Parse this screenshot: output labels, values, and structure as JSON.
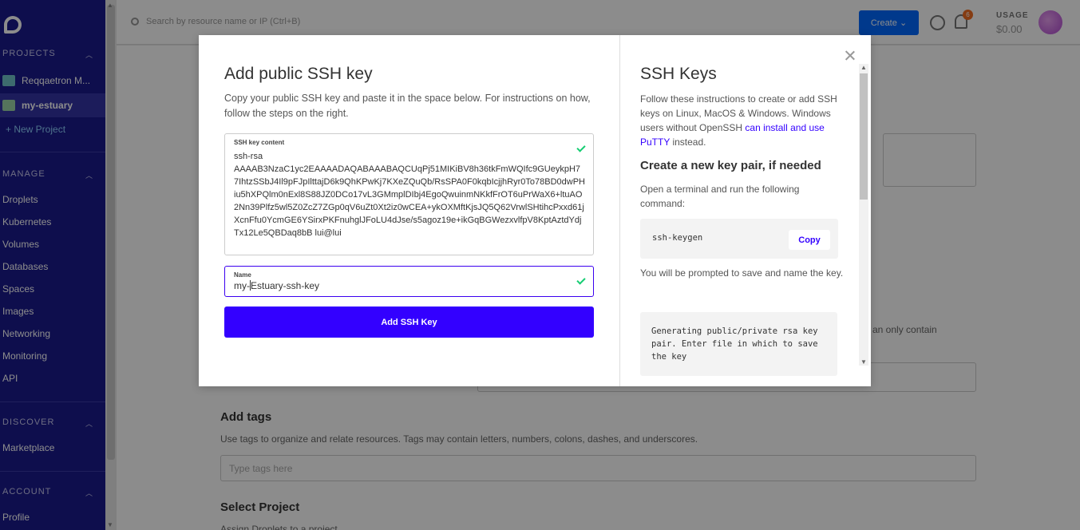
{
  "sidebar": {
    "projects_title": "PROJECTS",
    "projects": [
      {
        "label": "Reqqaetron M..."
      },
      {
        "label": "my-estuary"
      }
    ],
    "new_project": "+ New Project",
    "manage_title": "MANAGE",
    "manage_items": [
      "Droplets",
      "Kubernetes",
      "Volumes",
      "Databases",
      "Spaces",
      "Images",
      "Networking",
      "Monitoring",
      "API"
    ],
    "discover_title": "DISCOVER",
    "discover_items": [
      "Marketplace"
    ],
    "account_title": "ACCOUNT",
    "account_items": [
      "Profile"
    ]
  },
  "topbar": {
    "search_placeholder": "Search by resource name or IP (Ctrl+B)",
    "create_label": "Create",
    "notification_count": "6",
    "usage_label": "USAGE",
    "usage_value": "$0.00"
  },
  "background": {
    "partial_text": "an only contain",
    "add_tags_title": "Add tags",
    "add_tags_desc": "Use tags to organize and relate resources. Tags may contain letters, numbers, colons, dashes, and underscores.",
    "tags_placeholder": "Type tags here",
    "select_project_title": "Select Project",
    "select_project_desc": "Assign Droplets to a project"
  },
  "modal": {
    "title": "Add public SSH key",
    "description": "Copy your public SSH key and paste it in the space below. For instructions on how, follow the steps on the right.",
    "ssh_field_label": "SSH key content",
    "ssh_key_content": "ssh-rsa\nAAAAB3NzaC1yc2EAAAADAQABAAABAQCUqPj51MIKiBV8h36tkFmWQIfc9GUeykpH77IhtzSSbJ4Il9pFJpIlttajD6k9QhKPwKj7KXeZQuQb/RsSPA0F0kqbIcjjhRyr0To78BD0dwPHiu5hXPQlm0nExl8S88JZ0DCo17vL3GMmplDIbj4EgoQwuinmNKkfFrOT6uPrWaX6+ltuAO2Nn39Plfz5wl5Z0ZcZ7ZGp0qV6uZt0Xt2iz0wCEA+ykOXMftKjsJQ5Q62VrwlSHtihcPxxd61jXcnFfu0YcmGE6YSirxPKFnuhglJFoLU4dJse/s5agoz19e+ikGqBGWezxvlfpV8KptAztdYdjTx12Le5QBDaq8bB lui@lui",
    "name_field_label": "Name",
    "name_before_caret": "my-",
    "name_after_caret": "Estuary-ssh-key",
    "add_button": "Add SSH Key",
    "help": {
      "title": "SSH Keys",
      "intro_text": "Follow these instructions to create or add SSH keys on Linux, MacOS & Windows. Windows users without OpenSSH ",
      "intro_link": "can install and use PuTTY",
      "intro_end": " instead.",
      "subtitle": "Create a new key pair, if needed",
      "step1": "Open a terminal and run the following command:",
      "command": "ssh-keygen",
      "copy_label": "Copy",
      "step2": "You will be prompted to save and name the key.",
      "output": "Generating public/private rsa key pair. Enter file in which to save the key"
    }
  },
  "colors": {
    "sidebar": "#1a1a8c",
    "primary_button": "#3300ff",
    "focus_border": "#3b00f0",
    "success_check": "#15cd72",
    "link": "#3300ff"
  }
}
